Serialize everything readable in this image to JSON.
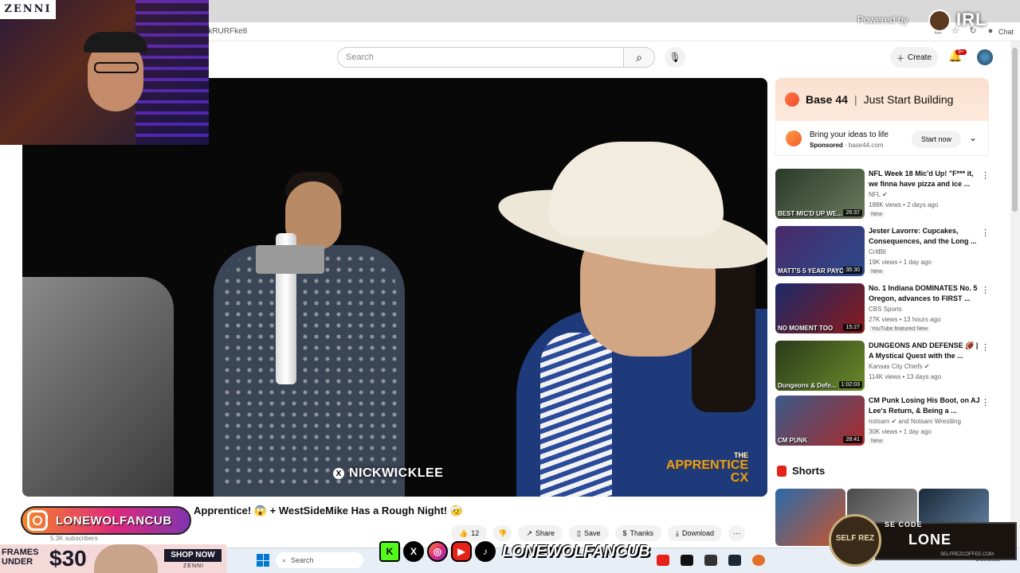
{
  "browser": {
    "url": "rkRURFke8",
    "chat_label": "Chat"
  },
  "header": {
    "search_placeholder": "Search",
    "create_label": "Create",
    "notif_count": "9+"
  },
  "video": {
    "handle": "NICKWICKLEE",
    "brand_line1": "THE",
    "brand_line2": "APPRENTICE",
    "brand_line3": "CX",
    "title": "Apprentice! 😱 + WestSideMike Has a Rough Night! 🤕",
    "subscribers": "5.3K subscribers"
  },
  "actions": {
    "like_count": "12",
    "share": "Share",
    "save": "Save",
    "thanks": "Thanks",
    "download": "Download"
  },
  "ad": {
    "brand": "Base 44",
    "sep": "|",
    "tagline": "Just Start Building",
    "body": "Bring your ideas to life",
    "sponsored": "Sponsored",
    "domain": "base44.com",
    "cta": "Start now"
  },
  "recommendations": [
    {
      "title": "NFL Week 18 Mic'd Up! \"F*** it, we finna have pizza and ice ...",
      "channel": "NFL ✔",
      "meta": "188K views • 2 days ago",
      "badge": "New",
      "duration": "26:37",
      "overlay": "BEST MIC'D UP WE...",
      "colors": [
        "#2a3a2a",
        "#6a7a5a"
      ]
    },
    {
      "title": "Jester Lavorre: Cupcakes, Consequences, and the Long ...",
      "channel": "CritBit",
      "meta": "19K views • 1 day ago",
      "badge": "New",
      "duration": "35:30",
      "overlay": "MATT'S 5 YEAR PAYOFF",
      "colors": [
        "#4a2a6a",
        "#2a4a8a"
      ]
    },
    {
      "title": "No. 1 Indiana DOMINATES No. 5 Oregon, advances to FIRST ...",
      "channel": "CBS Sports",
      "meta": "27K views • 13 hours ago",
      "badge": "YouTube featured   New",
      "duration": "15:27",
      "overlay": "NO MOMENT TOO",
      "colors": [
        "#1a2a6a",
        "#8a1a1a"
      ]
    },
    {
      "title": "DUNGEONS AND DEFENSE 🏈 | A Mystical Quest with the ...",
      "channel": "Kansas City Chiefs ✔",
      "meta": "114K views • 13 days ago",
      "badge": "",
      "duration": "1:02:03",
      "overlay": "Dungeons & Defe...",
      "colors": [
        "#2a3a1a",
        "#6a8a2a"
      ]
    },
    {
      "title": "CM Punk Losing His Boot, on AJ Lee's Return, & Being a ...",
      "channel": "notsam ✔ and Notsam Wrestling",
      "meta": "30K views • 1 day ago",
      "badge": "New",
      "duration": "28:41",
      "overlay": "CM PUNK",
      "colors": [
        "#3a5a8a",
        "#aa2a2a"
      ]
    }
  ],
  "shorts_label": "Shorts",
  "overlay": {
    "zenni": "ZENNI",
    "powered_by": "Powered by",
    "irl": "IRL",
    "ig_name": "LONEWOLFANCUB",
    "social_name": "LONEWOLFANCUB",
    "frames_line1": "FRAMES",
    "frames_line2": "UNDER",
    "frames_price": "$30",
    "shop_now": "SHOP NOW",
    "zenni_small": "ZENNI",
    "selfrez": "SELF REZ",
    "code_label": "SE CODE",
    "code_value": "LONE",
    "code_url": "SELFREZCOFFEE.COM"
  },
  "taskbar": {
    "search": "Search",
    "date": "1/10/2026"
  }
}
